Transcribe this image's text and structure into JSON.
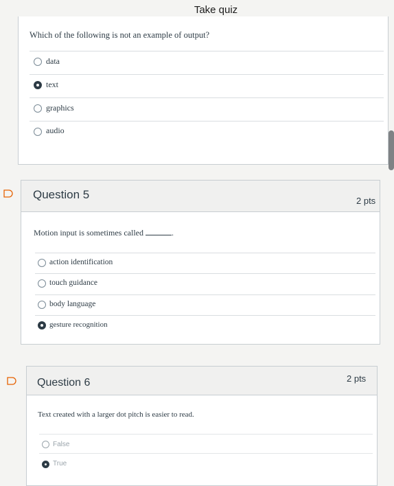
{
  "page": {
    "title": "Take quiz"
  },
  "question_4": {
    "text": "Which of the following is not an example of output?",
    "answers": [
      {
        "label": "data",
        "selected": false
      },
      {
        "label": "text",
        "selected": true
      },
      {
        "label": "graphics",
        "selected": false
      },
      {
        "label": "audio",
        "selected": false
      }
    ]
  },
  "question_5": {
    "title": "Question 5",
    "points": "2 pts",
    "text": "Motion input is sometimes called",
    "text_suffix": ".",
    "answers": [
      {
        "label": "action identification",
        "selected": false
      },
      {
        "label": "touch guidance",
        "selected": false
      },
      {
        "label": "body language",
        "selected": false
      },
      {
        "label": "gesture recognition",
        "selected": true
      }
    ]
  },
  "question_6": {
    "title": "Question 6",
    "points": "2 pts",
    "text": "Text created with a larger dot pitch is easier to read.",
    "answers": [
      {
        "label": "False",
        "selected": false
      },
      {
        "label": "True",
        "selected": true
      }
    ]
  },
  "colors": {
    "accent": "#2d3b45",
    "flag": "#e66000",
    "header_bg": "#f0f0ef"
  },
  "icons": {
    "flag": "bookmark-flag-icon"
  }
}
